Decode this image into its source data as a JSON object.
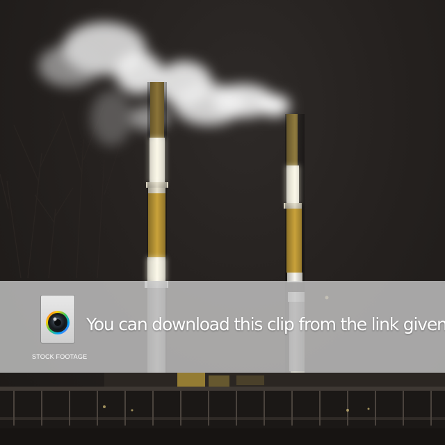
{
  "overlay": {
    "message": "You can download this clip from the link given below.",
    "logo_text": "STOCK FOOTAGE",
    "logo_icon": "camera-lens-icon",
    "banner_color": "#cdcdcd"
  },
  "scene": {
    "subject": "night smokestacks",
    "colors": {
      "sky": "#25211f",
      "smoke": "#f2f2f2",
      "stack_gold": "#c9a23a",
      "stack_white": "#f5f3e8"
    }
  }
}
